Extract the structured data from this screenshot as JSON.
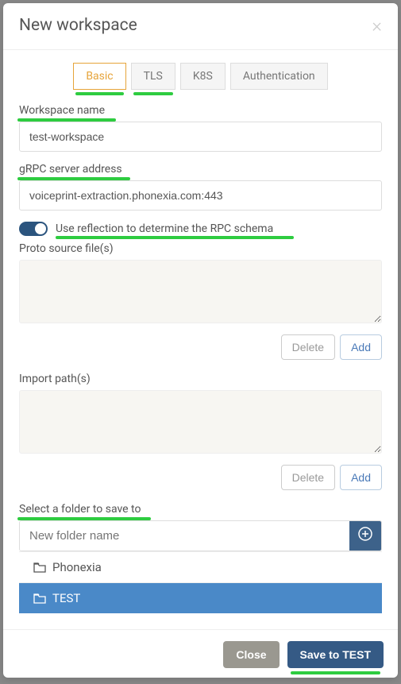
{
  "modal": {
    "title": "New workspace"
  },
  "tabs": {
    "basic": "Basic",
    "tls": "TLS",
    "k8s": "K8S",
    "auth": "Authentication"
  },
  "form": {
    "workspace_name_label": "Workspace name",
    "workspace_name_value": "test-workspace",
    "grpc_label": "gRPC server address",
    "grpc_value": "voiceprint-extraction.phonexia.com:443",
    "reflection_label": "Use reflection to determine the RPC schema",
    "proto_label": "Proto source file(s)",
    "import_label": "Import path(s)",
    "delete_label": "Delete",
    "add_label": "Add",
    "select_folder_label": "Select a folder to save to",
    "new_folder_placeholder": "New folder name"
  },
  "folders": {
    "item0": "Phonexia",
    "item1": "TEST"
  },
  "footer": {
    "close": "Close",
    "save": "Save to TEST"
  }
}
